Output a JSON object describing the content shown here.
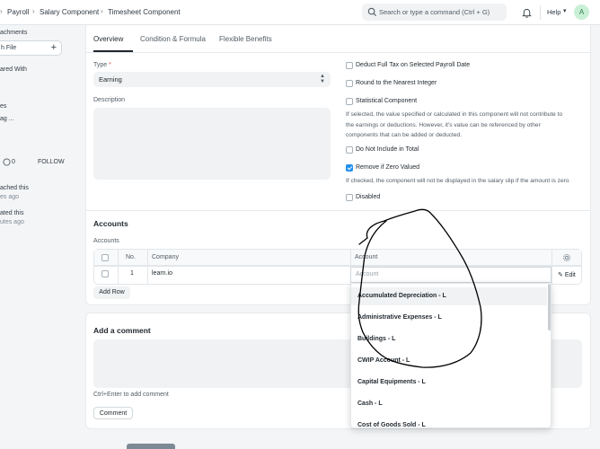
{
  "navbar": {
    "breadcrumbs": [
      "Payroll",
      "Salary Component",
      "Timesheet Component"
    ],
    "search_placeholder": "Search or type a command (Ctrl + G)",
    "help_label": "Help",
    "avatar_initial": "A"
  },
  "sidebar": {
    "attachments_label": "achments",
    "attach_file_label": "h File",
    "shared_with_label": "ared With",
    "tags_label": "es",
    "add_tag_label": "ag ...",
    "like_count": "0",
    "follow_label": "FOLLOW",
    "activity": [
      {
        "line1": "ached this",
        "line2": "es ago"
      },
      {
        "line1": "ated this",
        "line2": "utes ago"
      }
    ]
  },
  "tabs": [
    "Overview",
    "Condition & Formula",
    "Flexible Benefits"
  ],
  "form": {
    "type_label": "Type",
    "type_value": "Earning",
    "description_label": "Description",
    "checkboxes": [
      {
        "label": "Deduct Full Tax on Selected Payroll Date",
        "checked": false
      },
      {
        "label": "Round to the Nearest Integer",
        "checked": false
      },
      {
        "label": "Statistical Component",
        "checked": false
      },
      {
        "label": "Do Not Include in Total",
        "checked": false
      },
      {
        "label": "Remove if Zero Valued",
        "checked": true
      },
      {
        "label": "Disabled",
        "checked": false
      }
    ],
    "statistical_help": [
      "If selected, the value specified or calculated in this component will not contribute to",
      "the earnings or deductions. However, it's value can be referenced by other",
      "components that can be added or deducted."
    ],
    "zero_help": "If checked, the component will not be displayed in the salary slip if the amount is zero"
  },
  "accounts": {
    "section_title": "Accounts",
    "table_label": "Accounts",
    "columns": [
      "No.",
      "Company",
      "Account"
    ],
    "rows": [
      {
        "no": "1",
        "company": "learn.io",
        "account_placeholder": "Account"
      }
    ],
    "edit_label": "Edit",
    "add_row_label": "Add Row"
  },
  "account_dropdown": [
    "Accumulated Depreciation - L",
    "Administrative Expenses - L",
    "Buildings - L",
    "CWIP Account - L",
    "Capital Equipments - L",
    "Cash - L",
    "Cost of Goods Sold - L"
  ],
  "comment": {
    "title": "Add a comment",
    "hint": "Ctrl+Enter to add comment",
    "button_label": "Comment"
  },
  "colors": {
    "accent": "#2490ef",
    "required": "#e24c4c"
  }
}
